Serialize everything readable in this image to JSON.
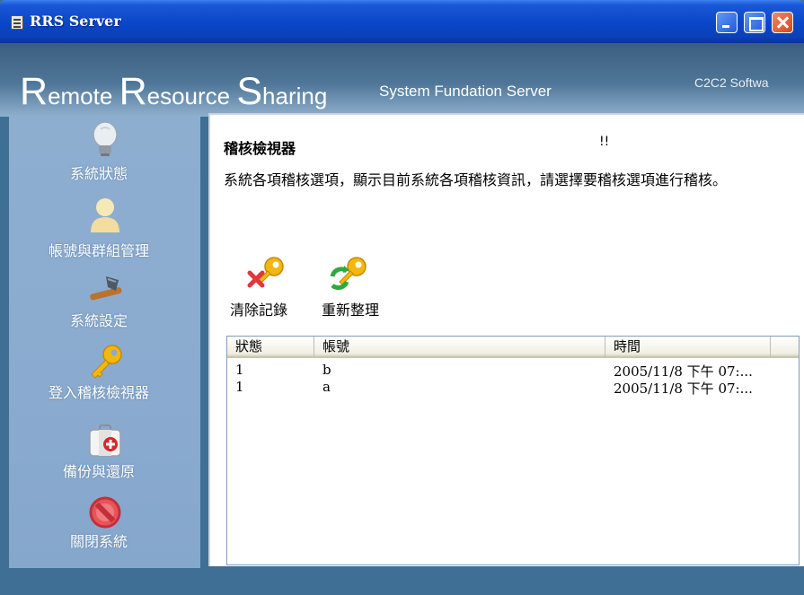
{
  "window": {
    "title": "RRS Server",
    "controls": {
      "minimize": "minimize-icon",
      "maximize": "maximize-icon",
      "close": "close-icon"
    }
  },
  "banner": {
    "title_parts": [
      {
        "big": "R",
        "small": "emote "
      },
      {
        "big": "R",
        "small": "esource "
      },
      {
        "big": "S",
        "small": "haring"
      }
    ],
    "subtitle": "System Fundation Server",
    "company": "C2C2  Softwa"
  },
  "sidebar": {
    "items": [
      {
        "label": "系統狀態",
        "icon": "lightbulb-icon"
      },
      {
        "label": "帳號與群組管理",
        "icon": "user-icon"
      },
      {
        "label": "系統設定",
        "icon": "hammer-icon"
      },
      {
        "label": "登入稽核檢視器",
        "icon": "key-icon"
      },
      {
        "label": "備份與還原",
        "icon": "first-aid-kit-icon"
      },
      {
        "label": "關閉系統",
        "icon": "no-entry-icon"
      }
    ]
  },
  "main": {
    "title": "稽核檢視器",
    "mark": "!!",
    "description": "系統各項稽核選項，顯示目前系統各項稽核資訊，請選擇要稽核選項進行稽核。",
    "actions": {
      "clear_label": "清除記錄",
      "clear_icon": "key-delete-icon",
      "reorg_label": "重新整理",
      "reorg_icon": "key-refresh-icon"
    },
    "list": {
      "columns": [
        "狀態",
        "帳號",
        "時間"
      ],
      "rows": [
        {
          "status": "1",
          "account": "b",
          "time": "2005/11/8 下午 07:..."
        },
        {
          "status": "1",
          "account": "a",
          "time": "2005/11/8 下午 07:..."
        }
      ]
    }
  },
  "colors": {
    "titlebar": "#0a46c8",
    "sidebar": "#8aabcf",
    "banner": "#4f7698",
    "frame": "#3f6f95"
  }
}
